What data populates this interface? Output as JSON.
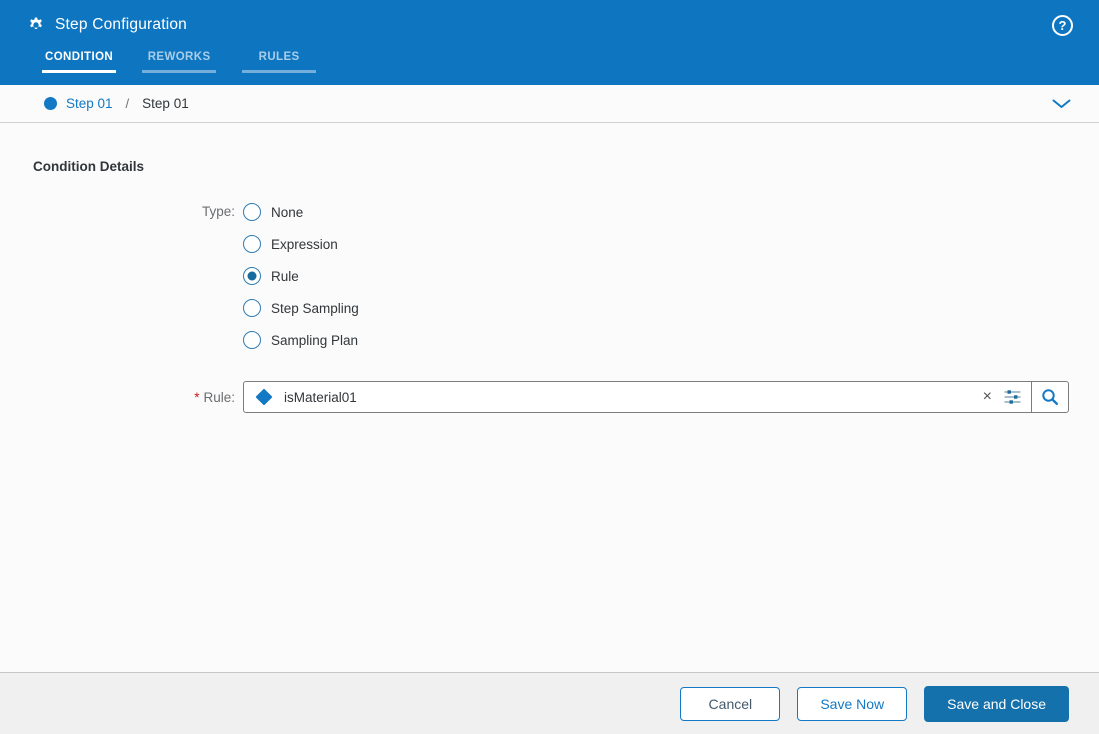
{
  "header": {
    "title": "Step Configuration",
    "help_glyph": "?",
    "tabs": [
      {
        "label": "CONDITION",
        "active": true
      },
      {
        "label": "REWORKS",
        "active": false
      },
      {
        "label": "RULES",
        "active": false
      }
    ]
  },
  "breadcrumb": {
    "step": "Step 01",
    "separator": "/",
    "current": "Step 01"
  },
  "content": {
    "section_title": "Condition Details",
    "type_label": "Type:",
    "type_options": [
      {
        "label": "None",
        "selected": false
      },
      {
        "label": "Expression",
        "selected": false
      },
      {
        "label": "Rule",
        "selected": true
      },
      {
        "label": "Step Sampling",
        "selected": false
      },
      {
        "label": "Sampling Plan",
        "selected": false
      }
    ],
    "rule_field": {
      "required_marker": "*",
      "label": "Rule:",
      "value": "isMaterial01",
      "clear_glyph": "×"
    }
  },
  "footer": {
    "buttons": [
      {
        "label": "Cancel",
        "primary": false
      },
      {
        "label": "Save Now",
        "primary": false
      },
      {
        "label": "Save and Close",
        "primary": true
      }
    ]
  },
  "icons": {
    "header_left": "gear-icon",
    "header_right": "help-icon",
    "breadcrumb_left": "step-status-dot-icon",
    "breadcrumb_right": "chevron-down-icon",
    "rule_value_prefix": "diamond-icon",
    "rule_field_actions": [
      "clear-icon",
      "value-help-sliders-icon",
      "search-magnifier-icon"
    ]
  },
  "colors": {
    "header_blue": "#0e76c0",
    "primary_blue": "#1379c4",
    "save_close_blue": "#1571ab",
    "required_red": "#cc1a1a",
    "footer_bg": "#f0f0f1",
    "page_bg": "#fbfbfb"
  }
}
